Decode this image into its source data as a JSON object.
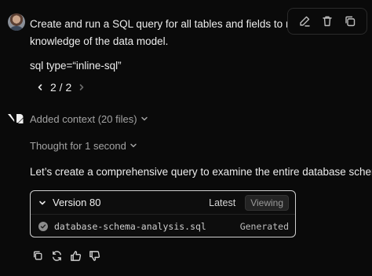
{
  "user_message": {
    "line1": "Create and run a SQL query for all tables and fields to refresh",
    "line2": "knowledge of the data model.",
    "sql_type": "sql type=“inline-sql”"
  },
  "message_actions": [
    "edit-icon",
    "delete-icon",
    "copy-icon"
  ],
  "pager": {
    "current": "2 / 2"
  },
  "assistant": {
    "context_label": "Added context (20 files)",
    "thought_label": "Thought for 1 second",
    "intro": "Let’s create a comprehensive query to examine the entire database schema:"
  },
  "version_card": {
    "title": "Version 80",
    "latest_label": "Latest",
    "viewing_label": "Viewing",
    "file_name": "database-schema-analysis.sql",
    "file_status": "Generated"
  },
  "feedback_icons": [
    "copy-icon",
    "regenerate-icon",
    "thumbs-up-icon",
    "thumbs-down-icon"
  ],
  "colors": {
    "background": "#0a0a0a",
    "text": "#ededed",
    "muted": "#a3a3a3",
    "card_border": "#cfcfcf"
  }
}
